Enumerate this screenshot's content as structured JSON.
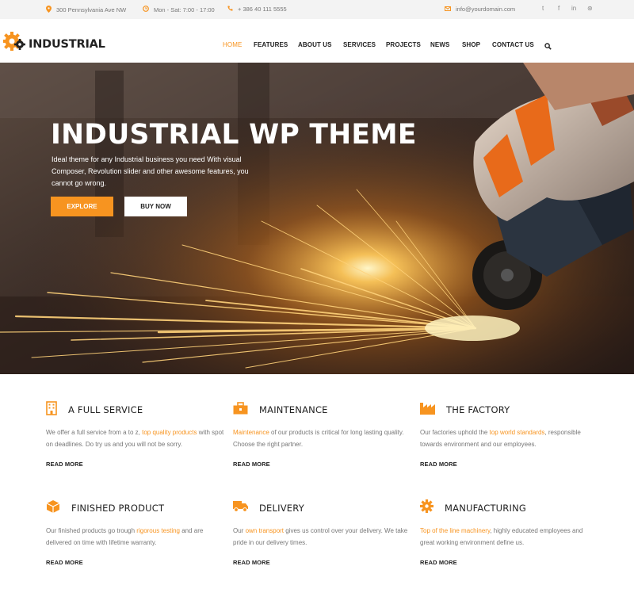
{
  "topbar": {
    "address": "300 Pennsylvania Ave NW",
    "hours": "Mon - Sat: 7:00 - 17:00",
    "phone": "+ 386 40 111 5555",
    "email": "info@yourdomain.com",
    "address_icon": "map-pin-icon",
    "hours_icon": "clock-icon",
    "phone_icon": "phone-icon",
    "email_icon": "envelope-icon",
    "social": [
      {
        "icon": "twitter-icon",
        "glyph": "t"
      },
      {
        "icon": "facebook-icon",
        "glyph": "f"
      },
      {
        "icon": "linkedin-icon",
        "glyph": "in"
      },
      {
        "icon": "wordpress-icon",
        "glyph": "⊛"
      }
    ]
  },
  "header": {
    "logo_text": "INDUSTRIAL",
    "logo_icon": "gear-icon",
    "nav": [
      "HOME",
      "FEATURES",
      "ABOUT US",
      "SERVICES",
      "PROJECTS",
      "NEWS",
      "SHOP",
      "CONTACT US"
    ],
    "search_icon": "search-icon"
  },
  "hero": {
    "title": "INDUSTRIAL WP THEME",
    "description": "Ideal theme for any Industrial business you need With visual Composer, Revolution slider and other awesome features, you cannot go wrong.",
    "explore_label": "EXPLORE",
    "buy_label": "BUY NOW"
  },
  "services": [
    {
      "title": "A FULL SERVICE",
      "icon": "building-icon",
      "pre": "We offer a full service from a to z, ",
      "hl": "top quality products",
      "post": " with spot on deadlines. Do try us and you will not be sorry.",
      "more": "READ MORE"
    },
    {
      "title": "MAINTENANCE",
      "icon": "toolbox-icon",
      "pre": "",
      "hl": "Maintenance",
      "post": " of our products is critical for long lasting quality. Choose the right partner.",
      "more": "READ MORE"
    },
    {
      "title": "THE FACTORY",
      "icon": "factory-icon",
      "pre": "Our factories uphold the ",
      "hl": "top world standards",
      "post": ", responsible towards environment and our employees.",
      "more": "READ MORE"
    },
    {
      "title": "FINISHED PRODUCT",
      "icon": "box-icon",
      "pre": "Our finished products go trough ",
      "hl": "rigorous testing",
      "post": " and are delivered on time with lifetime warranty.",
      "more": "READ MORE"
    },
    {
      "title": "DELIVERY",
      "icon": "truck-icon",
      "pre": "Our ",
      "hl": "own transport",
      "post": " gives us control over your delivery. We take pride in our delivery times.",
      "more": "READ MORE"
    },
    {
      "title": "MANUFACTURING",
      "icon": "cog-icon",
      "pre": "",
      "hl": "Top of the line machinery",
      "post": ", highly educated employees and great working environment define us.",
      "more": "READ MORE"
    }
  ],
  "colors": {
    "accent": "#f79420",
    "dark": "#222222",
    "muted": "#777777"
  }
}
